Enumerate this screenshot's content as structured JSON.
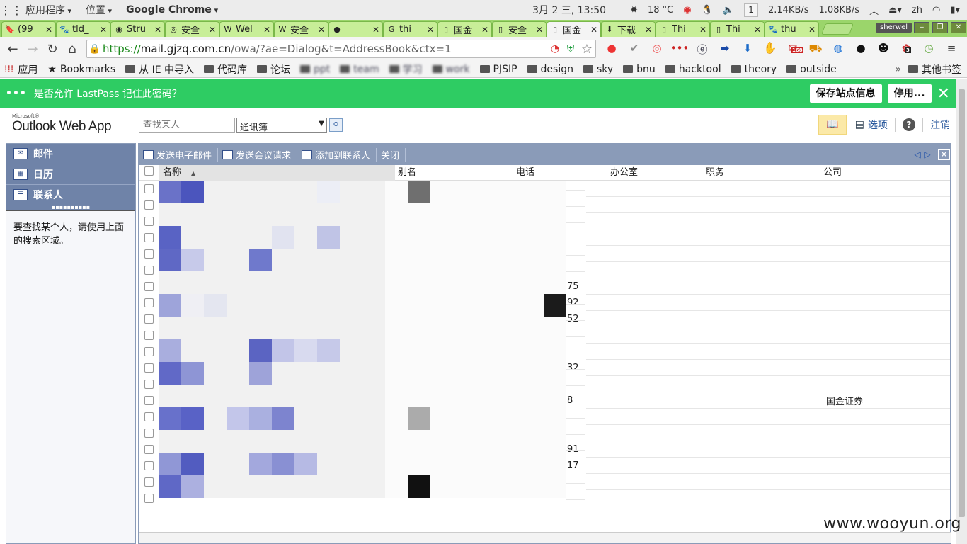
{
  "system_bar": {
    "apps_menu": "应用程序",
    "places_menu": "位置",
    "app_menu": "Google Chrome",
    "clock": "3月 2 三, 13:50",
    "weather": "18 °C",
    "workspace": "1",
    "net_down": "2.14KB/s",
    "net_up": "1.08KB/s",
    "lang": "zh"
  },
  "tabs": [
    {
      "title": "(99",
      "icon": "bookmark-icon"
    },
    {
      "title": "tld_",
      "icon": "paw-icon"
    },
    {
      "title": "Stru",
      "icon": "globe-icon"
    },
    {
      "title": "安全",
      "icon": "site-icon"
    },
    {
      "title": "Wel",
      "icon": "wikipedia-icon"
    },
    {
      "title": "安全",
      "icon": "wikipedia-icon"
    },
    {
      "title": "",
      "icon": "github-icon"
    },
    {
      "title": "thi",
      "icon": "google-icon"
    },
    {
      "title": "国金",
      "icon": "page-icon"
    },
    {
      "title": "安全",
      "icon": "page-icon"
    },
    {
      "title": "国金",
      "icon": "page-icon",
      "active": true
    },
    {
      "title": "下载",
      "icon": "download-icon"
    },
    {
      "title": "Thi",
      "icon": "page-icon"
    },
    {
      "title": "Thi",
      "icon": "page-icon"
    },
    {
      "title": "thu",
      "icon": "paw-icon"
    }
  ],
  "profile_name": "sherwel",
  "address_bar": {
    "protocol": "https://",
    "host": "mail.gjzq.com.cn",
    "path": "/owa/?ae=Dialog&t=AddressBook&ctx=1"
  },
  "extension_badges": {
    "mail_count": "168",
    "puzzle_count": "3"
  },
  "bookmarks": [
    {
      "label": "应用",
      "type": "apps"
    },
    {
      "label": "Bookmarks",
      "type": "star"
    },
    {
      "label": "从 IE 中导入",
      "type": "folder"
    },
    {
      "label": "代码库",
      "type": "folder"
    },
    {
      "label": "论坛",
      "type": "folder"
    },
    {
      "label": "ppt",
      "type": "folder",
      "blurred": true
    },
    {
      "label": "team",
      "type": "folder",
      "blurred": true
    },
    {
      "label": "学习",
      "type": "folder",
      "blurred": true
    },
    {
      "label": "work",
      "type": "folder",
      "blurred": true
    },
    {
      "label": "PJSIP",
      "type": "folder"
    },
    {
      "label": "design",
      "type": "folder"
    },
    {
      "label": "sky",
      "type": "folder"
    },
    {
      "label": "bnu",
      "type": "folder"
    },
    {
      "label": "hacktool",
      "type": "folder"
    },
    {
      "label": "theory",
      "type": "folder"
    },
    {
      "label": "outside",
      "type": "folder"
    }
  ],
  "bookmarks_more": "»",
  "bookmarks_other": "其他书签",
  "lastpass": {
    "prompt": "是否允许 LastPass 记住此密码？",
    "save_label": "保存站点信息",
    "disable_label": "停用...",
    "close": "✕"
  },
  "owa": {
    "logo_small": "Microsoft®",
    "logo": "Outlook Web App",
    "search_placeholder": "查找某人",
    "book_select": "通讯簿",
    "options_label": "选项",
    "help_label": "?",
    "logout_label": "注销"
  },
  "left_nav": {
    "items": [
      {
        "label": "邮件",
        "icon": "mail-icon"
      },
      {
        "label": "日历",
        "icon": "calendar-icon"
      },
      {
        "label": "联系人",
        "icon": "contacts-icon"
      }
    ],
    "hint": "要查找某个人，请使用上面的搜索区域。"
  },
  "toolbar": {
    "send_mail": "发送电子邮件",
    "send_meeting": "发送会议请求",
    "add_contact": "添加到联系人",
    "close": "关闭"
  },
  "columns": {
    "name": "名称",
    "alias": "别名",
    "phone": "电话",
    "office": "办公室",
    "title": "职务",
    "company": "公司"
  },
  "rows": [
    {
      "phone": "",
      "company": ""
    },
    {
      "phone": "",
      "company": ""
    },
    {
      "phone": "",
      "company": ""
    },
    {
      "phone": "",
      "company": ""
    },
    {
      "phone": "",
      "company": ""
    },
    {
      "phone": "",
      "company": ""
    },
    {
      "phone": "75",
      "company": ""
    },
    {
      "phone": "92",
      "company": ""
    },
    {
      "phone": "52",
      "company": ""
    },
    {
      "phone": "",
      "company": ""
    },
    {
      "phone": "",
      "company": ""
    },
    {
      "phone": "32",
      "company": ""
    },
    {
      "phone": "",
      "company": ""
    },
    {
      "phone": "8",
      "company": "国金证券"
    },
    {
      "phone": "",
      "company": ""
    },
    {
      "phone": "",
      "company": ""
    },
    {
      "phone": "91",
      "company": ""
    },
    {
      "phone": "17",
      "company": ""
    },
    {
      "phone": "",
      "company": ""
    },
    {
      "phone": "",
      "company": ""
    }
  ],
  "watermark": "www.wooyun.org"
}
